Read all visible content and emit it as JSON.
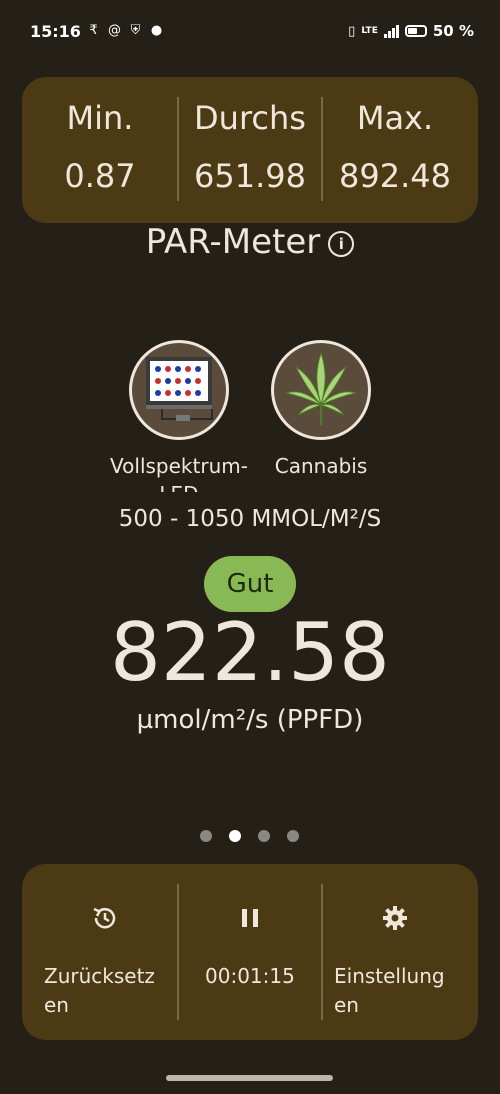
{
  "status_bar": {
    "time": "15:16",
    "battery": "50 %",
    "network": "LTE",
    "left_icons": [
      "rupee-icon",
      "threads-icon",
      "shield-icon",
      "reddit-icon"
    ]
  },
  "stats": {
    "min_label": "Min.",
    "min_value": "0.87",
    "avg_label": "Durchs",
    "avg_value": "651.98",
    "max_label": "Max.",
    "max_value": "892.48"
  },
  "page_title": "PAR-Meter",
  "light_source": {
    "label": "Vollspektrum-LED",
    "icon": "led-panel-icon"
  },
  "plant": {
    "label": "Cannabis",
    "icon": "cannabis-leaf-icon"
  },
  "range_text": "500 - 1050 MMOL/M²/S",
  "rating": {
    "label": "Gut",
    "color": "#89b954"
  },
  "reading": {
    "value": "822.58",
    "unit": "µmol/m²/s (PPFD)"
  },
  "pager": {
    "count": 4,
    "active_index": 1
  },
  "controls": {
    "reset_label": "Zurücksetzen",
    "reset_label_line1": "Zurücksetz",
    "reset_label_line2": "en",
    "timer": "00:01:15",
    "settings_label_line1": "Einstellung",
    "settings_label_line2": "en"
  },
  "colors": {
    "background": "#252017",
    "card": "#4b3a14",
    "accent_good": "#89b954",
    "text": "#efe6dc"
  }
}
